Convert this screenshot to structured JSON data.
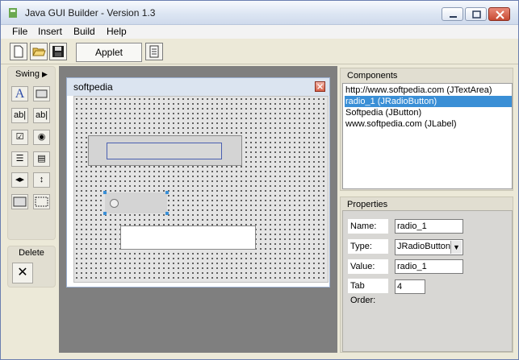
{
  "window": {
    "title": "Java GUI Builder - Version 1.3"
  },
  "menu": {
    "items": [
      "File",
      "Insert",
      "Build",
      "Help"
    ]
  },
  "toolbar": {
    "applet_label": "Applet"
  },
  "palette": {
    "header": "Swing",
    "delete_title": "Delete"
  },
  "frame": {
    "title": "softpedia"
  },
  "components_panel": {
    "title": "Components",
    "items": [
      "http://www.softpedia.com (JTextArea)",
      "radio_1 (JRadioButton)",
      "Softpedia (JButton)",
      "www.softpedia.com (JLabel)"
    ],
    "selected_index": 1
  },
  "properties_panel": {
    "title": "Properties",
    "name": {
      "label": "Name:",
      "value": "radio_1"
    },
    "type": {
      "label": "Type:",
      "value": "JRadioButton"
    },
    "value": {
      "label": "Value:",
      "value": "radio_1"
    },
    "tab_order": {
      "label": "Tab Order:",
      "value": "4"
    }
  },
  "colors": {
    "selection": "#3a8fd6",
    "title_bar": "#dde6f3",
    "window_bg": "#ece9d8"
  }
}
